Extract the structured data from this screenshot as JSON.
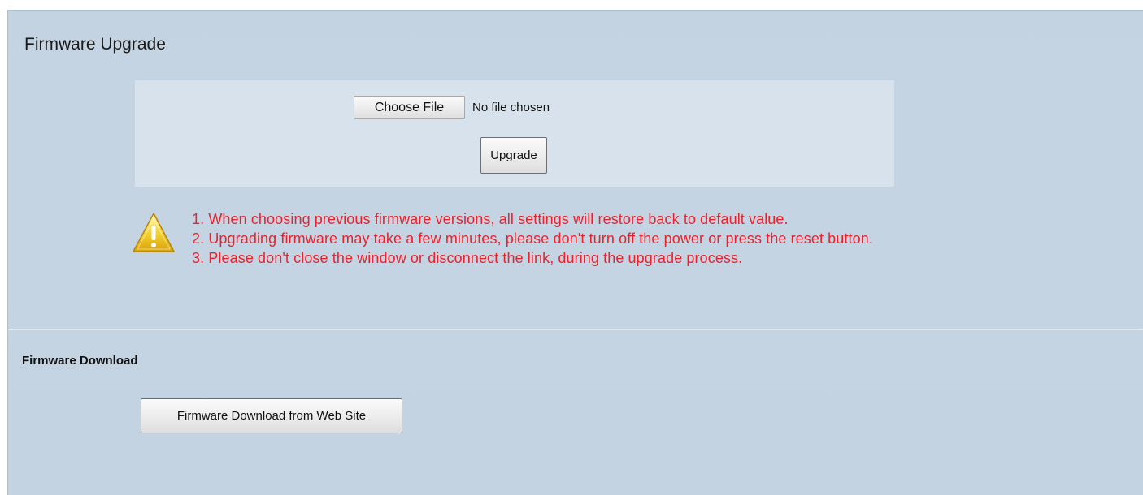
{
  "firmware_upgrade": {
    "title": "Firmware Upgrade",
    "choose_file_label": "Choose File",
    "file_status": "No file chosen",
    "upgrade_label": "Upgrade",
    "warnings": [
      "1. When choosing previous firmware versions, all settings will restore back to default value.",
      "2. Upgrading firmware may take a few minutes, please don't turn off the power or press the reset button.",
      "3. Please don't close the window or disconnect the link, during the upgrade process."
    ],
    "warning_icon": "warning-triangle-icon"
  },
  "firmware_download": {
    "title": "Firmware Download",
    "download_label": "Firmware Download from Web Site"
  },
  "colors": {
    "page_background": "#c4d4e3",
    "upload_box_background": "#d7e2ec",
    "warning_text": "#e8232e"
  }
}
